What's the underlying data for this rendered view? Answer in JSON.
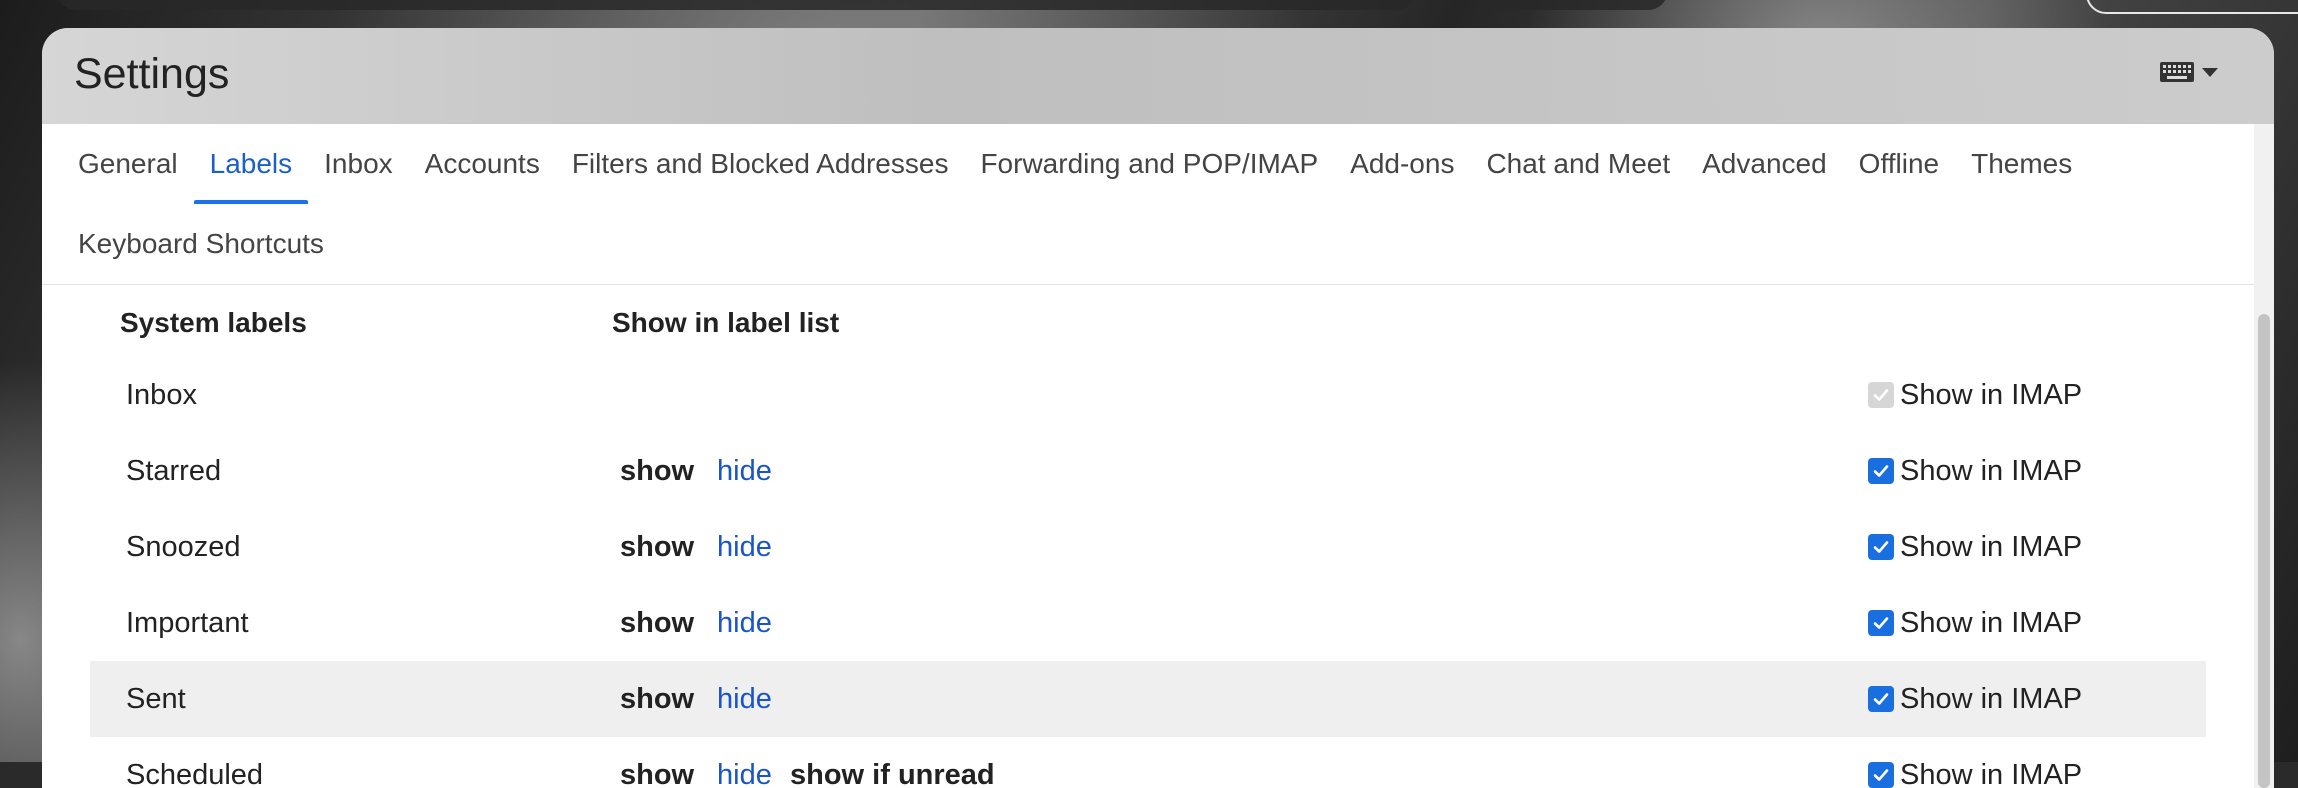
{
  "header": {
    "title": "Settings",
    "keyboard_icon": "keyboard-icon",
    "dropdown_icon": "caret-down-icon"
  },
  "tabs": [
    {
      "label": "General",
      "active": false
    },
    {
      "label": "Labels",
      "active": true
    },
    {
      "label": "Inbox",
      "active": false
    },
    {
      "label": "Accounts",
      "active": false
    },
    {
      "label": "Filters and Blocked Addresses",
      "active": false
    },
    {
      "label": "Forwarding and POP/IMAP",
      "active": false
    },
    {
      "label": "Add-ons",
      "active": false
    },
    {
      "label": "Chat and Meet",
      "active": false
    },
    {
      "label": "Advanced",
      "active": false
    },
    {
      "label": "Offline",
      "active": false
    },
    {
      "label": "Themes",
      "active": false
    }
  ],
  "tabs_row2": [
    {
      "label": "Keyboard Shortcuts",
      "active": false
    }
  ],
  "labels": {
    "col_system": "System labels",
    "col_show": "Show in label list",
    "rows": [
      {
        "name": "Inbox",
        "show": "",
        "hide": "",
        "imap": "Show in IMAP",
        "imap_checked": true,
        "imap_disabled": true
      },
      {
        "name": "Starred",
        "show": "show",
        "hide": "hide",
        "imap": "Show in IMAP",
        "imap_checked": true
      },
      {
        "name": "Snoozed",
        "show": "show",
        "hide": "hide",
        "imap": "Show in IMAP",
        "imap_checked": true
      },
      {
        "name": "Important",
        "show": "show",
        "hide": "hide",
        "imap": "Show in IMAP",
        "imap_checked": true
      },
      {
        "name": "Sent",
        "show": "show",
        "hide": "hide",
        "imap": "Show in IMAP",
        "imap_checked": true,
        "highlighted": true
      },
      {
        "name": "Scheduled",
        "show": "show",
        "hide": "hide",
        "extra": "show if unread",
        "imap": "Show in IMAP",
        "imap_checked": true
      }
    ]
  },
  "colors": {
    "accent": "#1a73e8",
    "link": "#1a55c8",
    "row_highlight": "#efefef"
  }
}
